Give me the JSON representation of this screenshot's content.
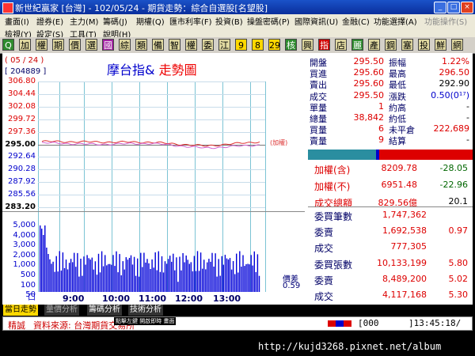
{
  "window": {
    "title": "新世紀贏家 [台灣] - 102/05/24 - 期貨走勢：綜合自選股[名望股]",
    "controls": [
      "_",
      "□",
      "×"
    ]
  },
  "menu": {
    "row1": [
      "畫面(I)",
      "證券(E)",
      "主力(M)",
      "籌碼(J)",
      "期權(Q)",
      "匯市利率(F)",
      "投資(B)",
      "操盤密碼(P)",
      "國際資訊(U)",
      "金融(C)",
      "功能選擇(A)",
      "功能操作(S)"
    ],
    "row2": [
      "檢視(Y)",
      "設定(S)",
      "工具(T)",
      "說明(H)"
    ]
  },
  "toolbar": {
    "buttons": [
      "Q",
      "加",
      "權",
      "期",
      "價",
      "選",
      "國",
      "綜",
      "類",
      "備",
      "智",
      "權",
      "委",
      "江",
      "9",
      "8",
      "29",
      "核",
      "興",
      "指",
      "店",
      "麗",
      "產",
      "鋼",
      "塞",
      "投",
      "鮮",
      "網"
    ],
    "colors": [
      "#2e8b2e",
      "#e0d8a0",
      "#e0d8a0",
      "#e0d8a0",
      "#e0d8a0",
      "#e0d8a0",
      "#a020a0",
      "#e0d8a0",
      "#e0d8a0",
      "#e0d8a0",
      "#e0d8a0",
      "#e0d8a0",
      "#e0d8a0",
      "#e0d8a0",
      "#ffd800",
      "#ffd800",
      "#ffd800",
      "#2e8b2e",
      "#e0d8a0",
      "#d00000",
      "#e0d8a0",
      "#2e8b2e",
      "#e0d8a0",
      "#e0d8a0",
      "#e0d8a0",
      "#e0d8a0",
      "#e0d8a0",
      "#e0d8a0"
    ]
  },
  "chart": {
    "date": "( 05 / 24 )",
    "id_code": "[ 204889 ]",
    "title_blue": "摩台指&",
    "title_red": "走勢圖",
    "price_labels": [
      "306.80",
      "304.44",
      "302.08",
      "299.72",
      "297.36",
      "295.00",
      "292.64",
      "290.28",
      "287.92",
      "285.56",
      "283.20"
    ],
    "vol_labels": [
      "5,000",
      "4,000",
      "3,000",
      "2,000",
      "1,000",
      "500",
      "100",
      "50",
      "口"
    ],
    "x_labels": [
      "9:00",
      "10:00",
      "11:00",
      "12:00",
      "13:00"
    ],
    "weight_label": "(加權)",
    "spread_label": "價差",
    "spread_value": "0.59"
  },
  "chart_data": {
    "type": "line",
    "title": "摩台指& 走勢圖",
    "xlabel": "",
    "ylabel": "",
    "x": [
      "9:00",
      "10:00",
      "11:00",
      "12:00",
      "13:00"
    ],
    "ylim": [
      283.2,
      306.8
    ],
    "series": [
      {
        "name": "摩台指&",
        "values": [
          295.55,
          295.45,
          295.4,
          294.7,
          295.5
        ]
      },
      {
        "name": "加權",
        "values": [
          295.3,
          295.0,
          295.2,
          294.3,
          294.9
        ]
      }
    ]
  },
  "quote": {
    "rows": [
      {
        "l1": "開盤",
        "v1": "295.50",
        "l2": "振幅",
        "v2": "1.22%",
        "c2": "#d00"
      },
      {
        "l1": "買進",
        "v1": "295.60",
        "l2": "最高",
        "v2": "296.50",
        "c2": "#d00"
      },
      {
        "l1": "賣出",
        "v1": "295.60",
        "l2": "最低",
        "v2": "292.90",
        "c2": "#000"
      },
      {
        "l1": "成交",
        "v1": "295.50",
        "l2": "漲跌",
        "v2": "0.50(0¹⁷)",
        "c2": "#00c"
      },
      {
        "l1": "單量",
        "v1": "1",
        "l2": "約高",
        "v2": "-",
        "c2": "#000"
      },
      {
        "l1": "總量",
        "v1": "38,842",
        "l2": "約低",
        "v2": "-",
        "c2": "#000"
      },
      {
        "l1": "買量",
        "v1": "6",
        "l2": "未平倉",
        "v2": "222,689",
        "c2": "#d00"
      },
      {
        "l1": "賣量",
        "v1": "9",
        "l2": "結算",
        "v2": "-",
        "c2": "#000"
      }
    ],
    "index_rows": [
      {
        "label": "加權(含)",
        "value": "8209.78",
        "change": "-28.05",
        "vc": "#d00",
        "cc": "#060"
      },
      {
        "label": "加權(不)",
        "value": "6951.48",
        "change": "-22.96",
        "vc": "#d00",
        "cc": "#060"
      },
      {
        "label": "成交總額",
        "value": "829.56億",
        "change": "20.1",
        "vc": "#d00",
        "cc": "#000"
      }
    ],
    "order_rows": [
      {
        "label": "委買筆數",
        "value": "1,747,362",
        "pct": ""
      },
      {
        "label": "委賣",
        "value": "1,692,538",
        "pct": "0.97"
      },
      {
        "label": "成交",
        "value": "777,305",
        "pct": ""
      },
      {
        "label": "委買張數",
        "value": "10,133,199",
        "pct": "5.80"
      },
      {
        "label": "委賣",
        "value": "8,489,200",
        "pct": "5.02"
      },
      {
        "label": "成交",
        "value": "4,117,168",
        "pct": "5.30"
      }
    ]
  },
  "tabs": [
    "當日走勢",
    "量價分析",
    "籌碼分析",
    "技術分析"
  ],
  "status": {
    "mode": "精誠",
    "source": "資料來源: 台灣期貨交易所",
    "popup": "點擊左鍵 開啟即時 畫面",
    "code": "[000",
    "time": "]13:45:18/"
  },
  "footer": {
    "url": "http://kujd3268.pixnet.net/album"
  }
}
